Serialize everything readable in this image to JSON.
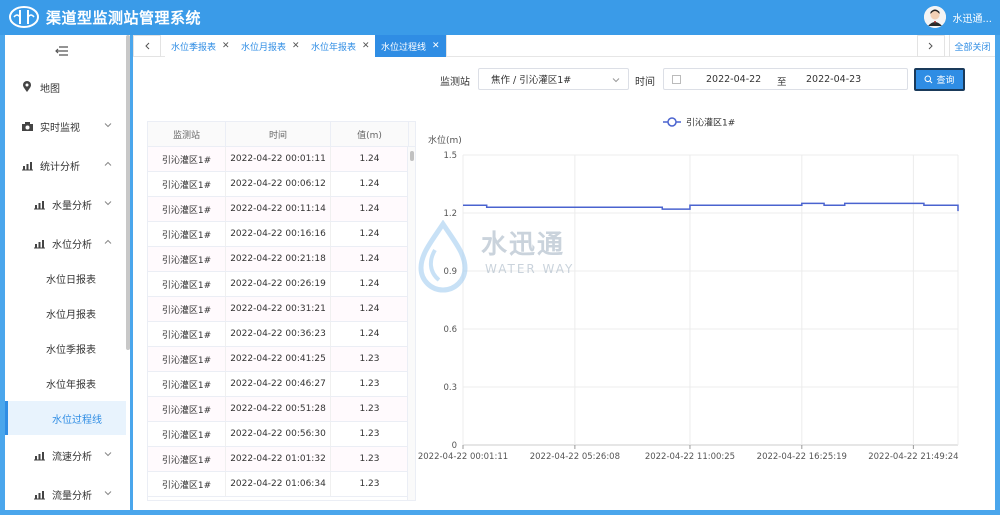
{
  "app": {
    "title": "渠道型监测站管理系统",
    "user": "水迅通..."
  },
  "sidebar": {
    "items": [
      {
        "label": "地图"
      },
      {
        "label": "实时监视"
      },
      {
        "label": "统计分析"
      },
      {
        "label": "水量分析"
      },
      {
        "label": "水位分析"
      },
      {
        "label": "流速分析"
      },
      {
        "label": "流量分析"
      }
    ],
    "sub_items": [
      {
        "label": "水位日报表"
      },
      {
        "label": "水位月报表"
      },
      {
        "label": "水位季报表"
      },
      {
        "label": "水位年报表"
      },
      {
        "label": "水位过程线"
      }
    ]
  },
  "tabs": [
    {
      "label": "水位季报表"
    },
    {
      "label": "水位月报表"
    },
    {
      "label": "水位年报表"
    },
    {
      "label": "水位过程线"
    }
  ],
  "tabs_close_all": "全部关闭",
  "filters": {
    "station_label": "监测站",
    "station_value": "焦作 / 引沁灌区1#",
    "time_label": "时间",
    "start_date": "2022-04-22",
    "range_sep": "至",
    "end_date": "2022-04-23",
    "query_label": "查询"
  },
  "table": {
    "headers": [
      "监测站",
      "时间",
      "值(m)"
    ],
    "rows": [
      [
        "引沁灌区1#",
        "2022-04-22 00:01:11",
        "1.24"
      ],
      [
        "引沁灌区1#",
        "2022-04-22 00:06:12",
        "1.24"
      ],
      [
        "引沁灌区1#",
        "2022-04-22 00:11:14",
        "1.24"
      ],
      [
        "引沁灌区1#",
        "2022-04-22 00:16:16",
        "1.24"
      ],
      [
        "引沁灌区1#",
        "2022-04-22 00:21:18",
        "1.24"
      ],
      [
        "引沁灌区1#",
        "2022-04-22 00:26:19",
        "1.24"
      ],
      [
        "引沁灌区1#",
        "2022-04-22 00:31:21",
        "1.24"
      ],
      [
        "引沁灌区1#",
        "2022-04-22 00:36:23",
        "1.24"
      ],
      [
        "引沁灌区1#",
        "2022-04-22 00:41:25",
        "1.23"
      ],
      [
        "引沁灌区1#",
        "2022-04-22 00:46:27",
        "1.23"
      ],
      [
        "引沁灌区1#",
        "2022-04-22 00:51:28",
        "1.23"
      ],
      [
        "引沁灌区1#",
        "2022-04-22 00:56:30",
        "1.23"
      ],
      [
        "引沁灌区1#",
        "2022-04-22 01:01:32",
        "1.23"
      ],
      [
        "引沁灌区1#",
        "2022-04-22 01:06:34",
        "1.23"
      ]
    ]
  },
  "watermark": {
    "title": "水迅通",
    "subtitle": "WATER WAY"
  },
  "chart_data": {
    "type": "line",
    "ylabel": "水位(m)",
    "ylim": [
      0,
      1.5
    ],
    "yticks": [
      "0",
      "0.3",
      "0.6",
      "0.9",
      "1.2",
      "1.5"
    ],
    "xticks": [
      "2022-04-22 00:01:11",
      "2022-04-22 05:26:08",
      "2022-04-22 11:00:25",
      "2022-04-22 16:25:19",
      "2022-04-22 21:49:24"
    ],
    "grid": true,
    "legend": "top-center",
    "series": [
      {
        "name": "引沁灌区1#",
        "color": "#4a63cf",
        "x": [
          "2022-04-22 00:01:11",
          "2022-04-22 01:10:00",
          "2022-04-22 02:40:00",
          "2022-04-22 04:30:00",
          "2022-04-22 05:26:08",
          "2022-04-22 08:20:00",
          "2022-04-22 09:40:00",
          "2022-04-22 11:00:25",
          "2022-04-22 13:30:00",
          "2022-04-22 16:00:00",
          "2022-04-22 16:25:19",
          "2022-04-22 17:30:00",
          "2022-04-22 18:30:00",
          "2022-04-22 21:49:24",
          "2022-04-22 22:20:00",
          "2022-04-22 23:59:00"
        ],
        "y": [
          1.24,
          1.23,
          1.23,
          1.23,
          1.23,
          1.23,
          1.22,
          1.24,
          1.24,
          1.24,
          1.25,
          1.24,
          1.25,
          1.25,
          1.24,
          1.21
        ]
      }
    ]
  }
}
